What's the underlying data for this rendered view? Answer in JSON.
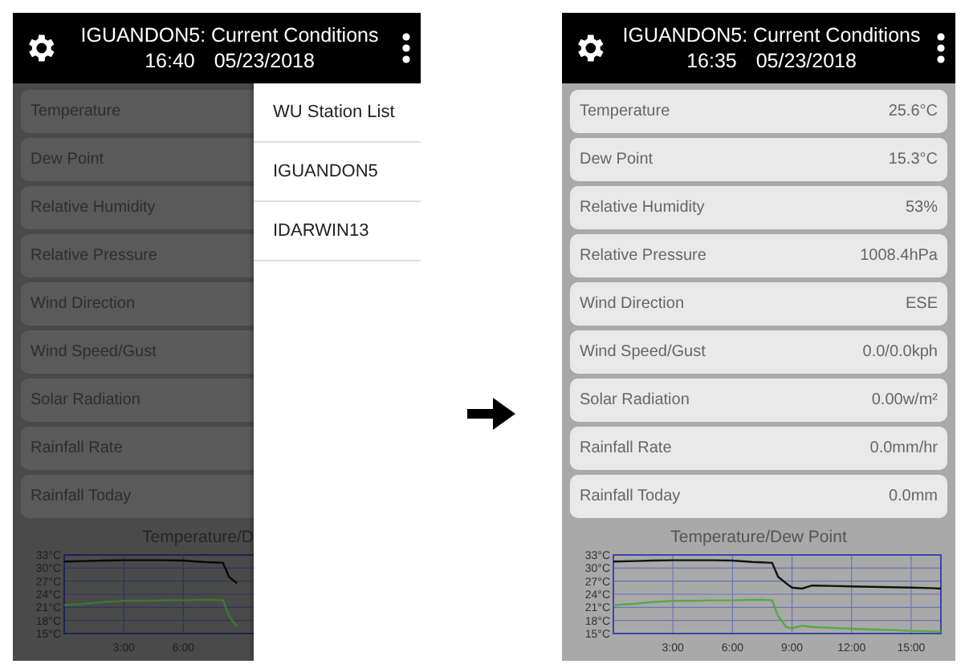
{
  "screens": [
    {
      "header": {
        "title": "IGUANDON5: Current Conditions",
        "time": "16:40",
        "date": "05/23/2018"
      },
      "dimmed": true,
      "conditions": [
        {
          "label": "Temperature"
        },
        {
          "label": "Dew Point"
        },
        {
          "label": "Relative Humidity"
        },
        {
          "label": "Relative Pressure"
        },
        {
          "label": "Wind Direction"
        },
        {
          "label": "Wind Speed/Gust"
        },
        {
          "label": "Solar Radiation"
        },
        {
          "label": "Rainfall Rate"
        },
        {
          "label": "Rainfall Today"
        }
      ],
      "chart": {
        "title": "Temperature/D",
        "chart_data": {
          "type": "line",
          "grid": true,
          "x": [
            0,
            1,
            2,
            3,
            4,
            5,
            6,
            7,
            7.5,
            8,
            8.3,
            8.7
          ],
          "xlim": [
            0,
            16.5
          ],
          "ylim": [
            15,
            33
          ],
          "xticks": [
            {
              "value": 3,
              "label": "3:00"
            },
            {
              "value": 6,
              "label": "6:00"
            }
          ],
          "yticks": [
            {
              "value": 15,
              "label": "15°C"
            },
            {
              "value": 18,
              "label": "18°C"
            },
            {
              "value": 21,
              "label": "21°C"
            },
            {
              "value": 24,
              "label": "24°C"
            },
            {
              "value": 27,
              "label": "27°C"
            },
            {
              "value": 30,
              "label": "30°C"
            },
            {
              "value": 33,
              "label": "33°C"
            }
          ],
          "series": [
            {
              "color": "#080808",
              "values": [
                31.5,
                31.6,
                31.7,
                31.8,
                31.8,
                31.8,
                31.7,
                31.4,
                31.3,
                31.2,
                28,
                26.5
              ]
            },
            {
              "color": "#3a7a30",
              "values": [
                21.5,
                21.8,
                22.2,
                22.5,
                22.5,
                22.6,
                22.6,
                22.7,
                22.7,
                22.6,
                19,
                16.5
              ]
            }
          ]
        }
      },
      "menu": {
        "items": [
          {
            "label": "WU Station List"
          },
          {
            "label": "IGUANDON5"
          },
          {
            "label": "IDARWIN13"
          }
        ]
      }
    },
    {
      "header": {
        "title": "IGUANDON5: Current Conditions",
        "time": "16:35",
        "date": "05/23/2018"
      },
      "dimmed": false,
      "conditions": [
        {
          "label": "Temperature",
          "value": "25.6°C"
        },
        {
          "label": "Dew Point",
          "value": "15.3°C"
        },
        {
          "label": "Relative Humidity",
          "value": "53%"
        },
        {
          "label": "Relative Pressure",
          "value": "1008.4hPa"
        },
        {
          "label": "Wind Direction",
          "value": "ESE"
        },
        {
          "label": "Wind Speed/Gust",
          "value": "0.0/0.0kph"
        },
        {
          "label": "Solar Radiation",
          "value": "0.00w/m²"
        },
        {
          "label": "Rainfall Rate",
          "value": "0.0mm/hr"
        },
        {
          "label": "Rainfall Today",
          "value": "0.0mm"
        }
      ],
      "chart": {
        "title": "Temperature/Dew Point",
        "chart_data": {
          "type": "line",
          "grid": true,
          "x": [
            0,
            1,
            2,
            3,
            4,
            5,
            6,
            7,
            7.5,
            8,
            8.3,
            8.7,
            9,
            9.5,
            10,
            11,
            12,
            13,
            14,
            15,
            16,
            16.5
          ],
          "xlim": [
            0,
            16.5
          ],
          "ylim": [
            15,
            33
          ],
          "xticks": [
            {
              "value": 3,
              "label": "3:00"
            },
            {
              "value": 6,
              "label": "6:00"
            },
            {
              "value": 9,
              "label": "9:00"
            },
            {
              "value": 12,
              "label": "12:00"
            },
            {
              "value": 15,
              "label": "15:00"
            }
          ],
          "yticks": [
            {
              "value": 15,
              "label": "15°C"
            },
            {
              "value": 18,
              "label": "18°C"
            },
            {
              "value": 21,
              "label": "21°C"
            },
            {
              "value": 24,
              "label": "24°C"
            },
            {
              "value": 27,
              "label": "27°C"
            },
            {
              "value": 30,
              "label": "30°C"
            },
            {
              "value": 33,
              "label": "33°C"
            }
          ],
          "series": [
            {
              "color": "#111111",
              "values": [
                31.5,
                31.6,
                31.7,
                31.8,
                31.8,
                31.8,
                31.7,
                31.4,
                31.3,
                31.2,
                28,
                26.5,
                25.5,
                25.3,
                26,
                25.9,
                25.8,
                25.7,
                25.6,
                25.5,
                25.4,
                25.3
              ]
            },
            {
              "color": "#55aa44",
              "values": [
                21.5,
                21.8,
                22.2,
                22.5,
                22.5,
                22.6,
                22.6,
                22.7,
                22.7,
                22.6,
                19,
                16.5,
                16.2,
                16.8,
                16.5,
                16.3,
                16.1,
                15.9,
                15.8,
                15.6,
                15.5,
                15.4
              ]
            }
          ]
        }
      }
    }
  ]
}
